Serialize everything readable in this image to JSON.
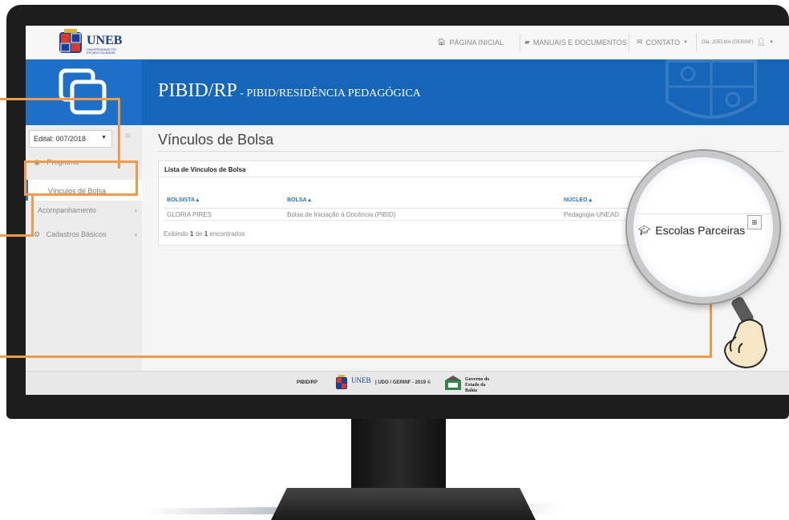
{
  "app": {
    "brand": "UNEB",
    "brand_sub": "UNIVERSIDADE DO ESTADO DA BAHIA"
  },
  "topnav": {
    "home": "PÁGINA INICIAL",
    "manuals": "MANUAIS E DOCUMENTOS",
    "contact": "CONTATO",
    "user": "Olá, JOELMA (GERINF)"
  },
  "banner": {
    "title": "PIBID/RP",
    "subtitle": " - PIBID/RESIDÊNCIA PEDAGÓGICA"
  },
  "sidebar": {
    "edital": "Edital: 007/2018",
    "items": [
      {
        "label": "Programa"
      },
      {
        "label": "Vínculos de Bolsa"
      },
      {
        "label": "Acompanhamento"
      },
      {
        "label": "Cadastros Básicos"
      }
    ]
  },
  "main": {
    "title": "Vínculos de Bolsa",
    "panel_title": "Lista de Vínculos de Bolsa",
    "columns": [
      "BOLSISTA",
      "BOLSA",
      "NÚCLEO"
    ],
    "rows": [
      {
        "bolsista": "GLORIA PIRES",
        "bolsa": "Bolsa de Iniciação à Docência (PIBID)",
        "nucleo": "Pedagogia-UNEAD"
      }
    ],
    "count_prefix": "Exibindo ",
    "count_shown": "1",
    "count_mid": " de ",
    "count_total": "1",
    "count_suffix": " encontrados"
  },
  "footer": {
    "left": "PIBID/RP",
    "uneb": "UNEB",
    "right": "| UDO / GERINF - 2019 ©",
    "gov": "Governo do Estado da Bahia"
  },
  "magnifier": {
    "menu_label": "Escolas Parceiras"
  },
  "colors": {
    "banner": "#1565b8",
    "link": "#2a72c8",
    "callout": "#f19a4a"
  }
}
